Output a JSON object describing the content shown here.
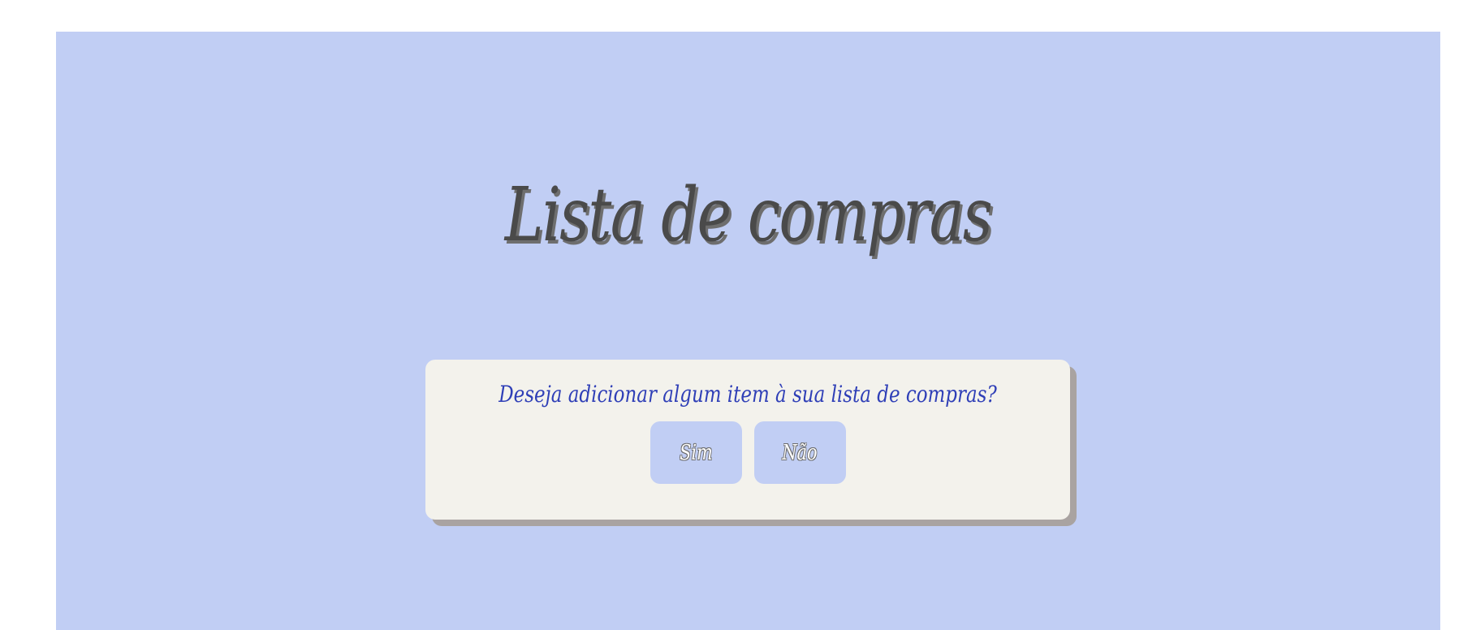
{
  "page": {
    "title": "Lista de compras"
  },
  "dialog": {
    "question": "Deseja adicionar algum item à sua lista de compras?",
    "yes_label": "Sim",
    "no_label": "Não"
  },
  "colors": {
    "background": "#c1cef4",
    "card": "#f3f2ec",
    "card_shadow": "#a9a3a1",
    "title": "#4a4a4a",
    "question": "#2f3fb7",
    "button": "#c1cef4"
  }
}
